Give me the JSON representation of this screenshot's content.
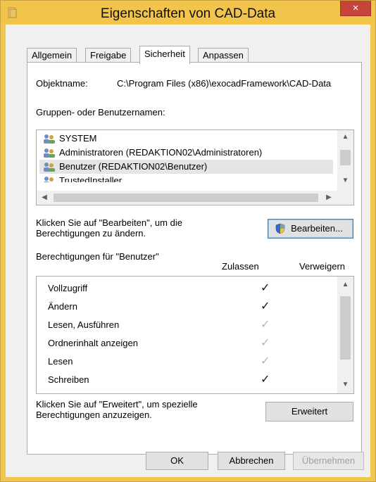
{
  "window": {
    "title": "Eigenschaften von CAD-Data",
    "close_label": "×",
    "accent": "#f2c44c"
  },
  "tabs": [
    {
      "label": "Allgemein"
    },
    {
      "label": "Freigabe"
    },
    {
      "label": "Sicherheit"
    },
    {
      "label": "Anpassen"
    }
  ],
  "security": {
    "object_label": "Objektname:",
    "object_value": "C:\\Program Files (x86)\\exocadFramework\\CAD-Data",
    "groups_label": "Gruppen- oder Benutzernamen:",
    "groups": [
      {
        "name": "SYSTEM"
      },
      {
        "name": "Administratoren (REDAKTION02\\Administratoren)"
      },
      {
        "name": "Benutzer (REDAKTION02\\Benutzer)"
      },
      {
        "name": "TrustedInstaller"
      }
    ],
    "edit_hint_line1": "Klicken Sie auf \"Bearbeiten\", um die",
    "edit_hint_line2": "Berechtigungen zu ändern.",
    "edit_button": "Bearbeiten...",
    "perm_header": "Berechtigungen für \"Benutzer\"",
    "col_allow": "Zulassen",
    "col_deny": "Verweigern",
    "permissions": [
      {
        "name": "Vollzugriff",
        "allow": "✓",
        "allow_state": "black"
      },
      {
        "name": "Ändern",
        "allow": "✓",
        "allow_state": "black"
      },
      {
        "name": "Lesen, Ausführen",
        "allow": "✓",
        "allow_state": "gray"
      },
      {
        "name": "Ordnerinhalt anzeigen",
        "allow": "✓",
        "allow_state": "gray"
      },
      {
        "name": "Lesen",
        "allow": "✓",
        "allow_state": "gray"
      },
      {
        "name": "Schreiben",
        "allow": "✓",
        "allow_state": "black"
      }
    ],
    "advanced_hint_line1": "Klicken Sie auf \"Erweitert\", um spezielle",
    "advanced_hint_line2": "Berechtigungen anzuzeigen.",
    "advanced_button": "Erweitert"
  },
  "footer": {
    "ok": "OK",
    "cancel": "Abbrechen",
    "apply": "Übernehmen"
  }
}
